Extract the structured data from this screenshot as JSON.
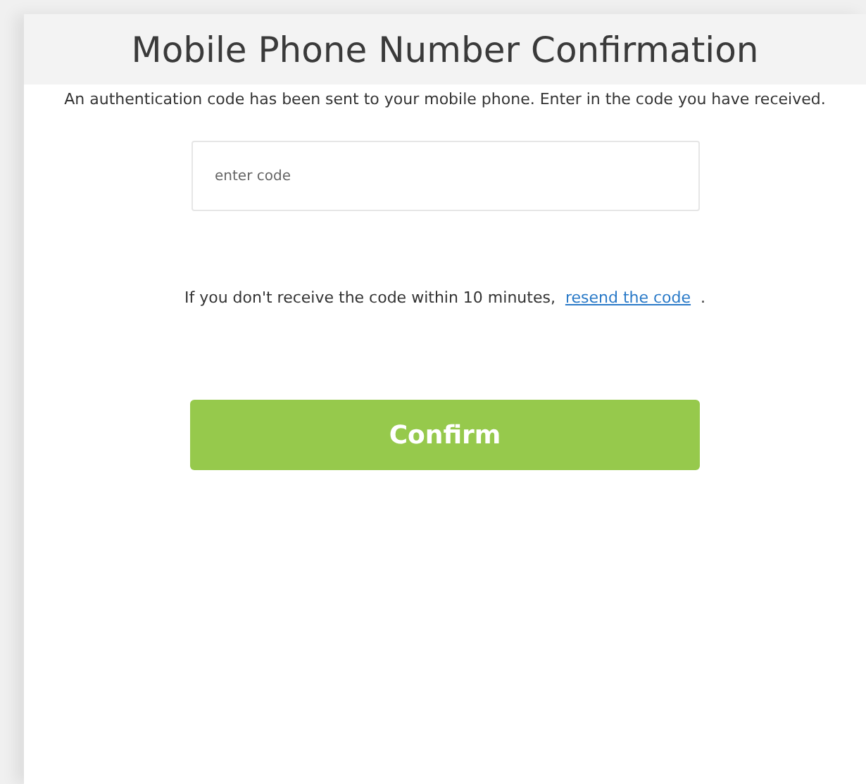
{
  "title": "Mobile Phone Number Confirmation",
  "instructions": "An authentication code has been sent to your mobile phone. Enter in the code you have received.",
  "code_field": {
    "placeholder": "enter code"
  },
  "resend_notice": {
    "before": "If you don't receive the code within 10 minutes,",
    "link": "resend the code",
    "after": "."
  },
  "confirm_button": {
    "label": "Confirm"
  }
}
